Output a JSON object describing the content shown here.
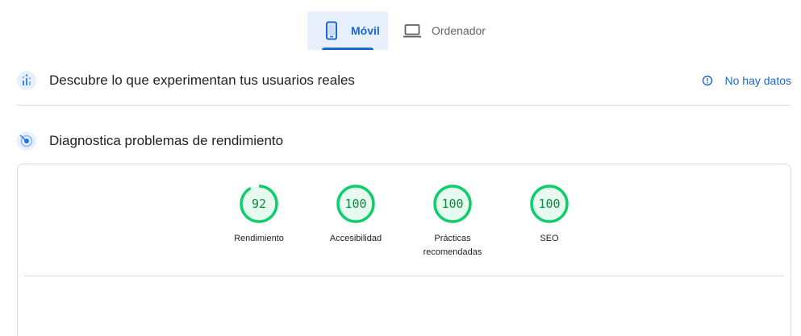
{
  "tabs": [
    {
      "label": "Móvil",
      "icon": "smartphone-icon",
      "active": true
    },
    {
      "label": "Ordenador",
      "icon": "laptop-icon",
      "active": false
    }
  ],
  "field_data": {
    "title": "Descubre lo que experimentan tus usuarios reales",
    "status": "No hay datos",
    "icon": "user-data-icon",
    "status_icon": "info-icon"
  },
  "lab_data": {
    "title": "Diagnostica problemas de rendimiento",
    "icon": "lab-data-icon"
  },
  "scores": [
    {
      "label": "Rendimiento",
      "value": 92
    },
    {
      "label": "Accesibilidad",
      "value": 100
    },
    {
      "label": "Prácticas recomendadas",
      "value": 100
    },
    {
      "label": "SEO",
      "value": 100
    }
  ],
  "colors": {
    "accent": "#1967d2",
    "pass": "#0cce6b",
    "pass_bg": "#e6faef",
    "pass_text": "#0c8a3e"
  }
}
